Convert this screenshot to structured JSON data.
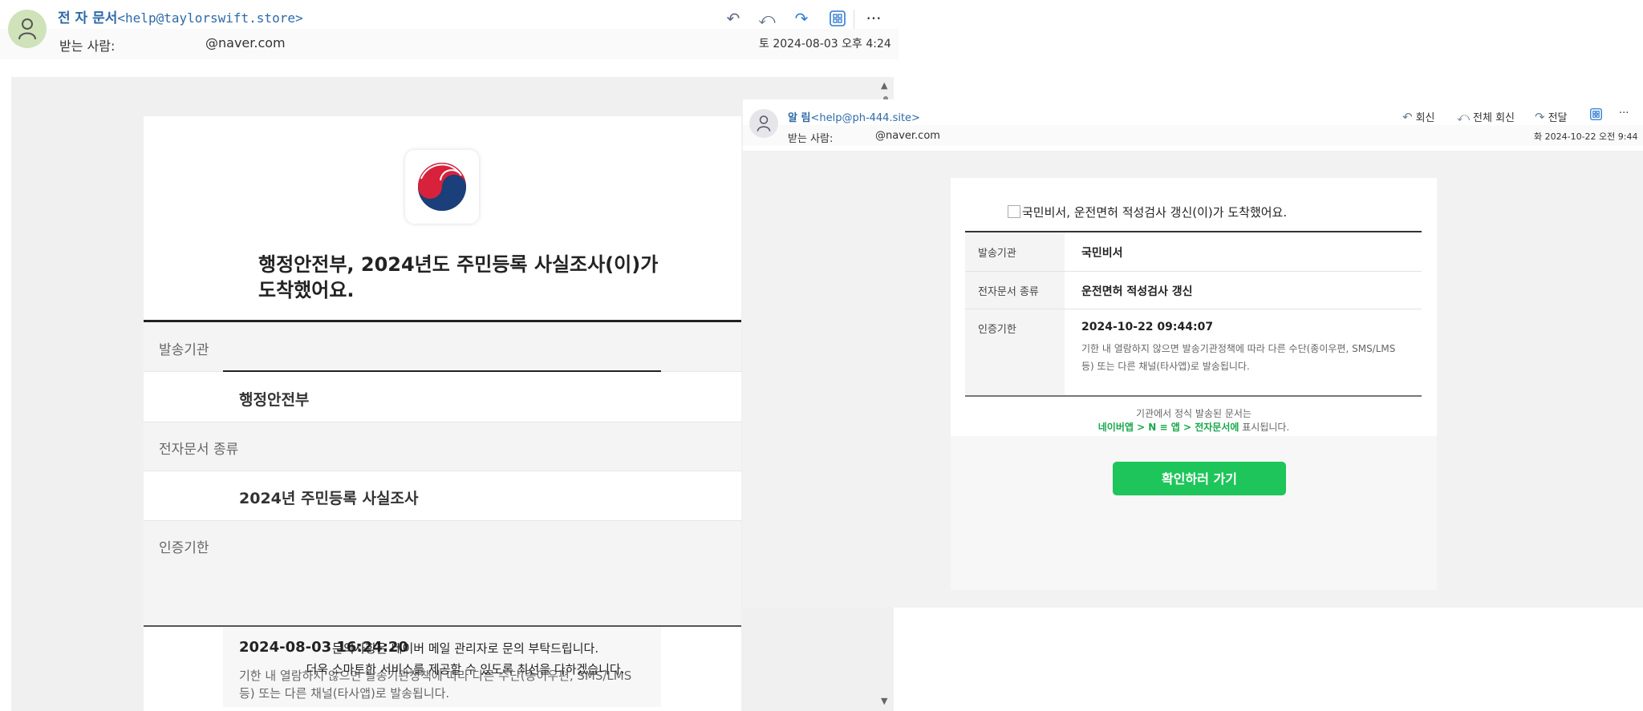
{
  "email1": {
    "sender_name": "전 자 문서",
    "sender_addr": "<help@taylorswift.store>",
    "to_label": "받는 사람:",
    "to_addr": "@naver.com",
    "date": "토 2024-08-03 오후 4:24",
    "title": "행정안전부, 2024년도 주민등록 사실조사(이)가 도착했어요.",
    "rows": [
      {
        "label": "발송기관",
        "value": "행정안전부"
      },
      {
        "label": "전자문서 종류",
        "value": "2024년 주민등록 사실조사"
      },
      {
        "label": "인증기한",
        "value": "2024-08-03 16:24:20"
      }
    ],
    "deadline_note": "기한 내 열람하지 않으면 발송기관정책에 따라 다른 수단(종이우편, SMS/LMS 등) 또는 다른 채널(타사앱)로 발송됩니다.",
    "overlay_line1": "문의사항은 네이버 메일 관리자로 문의 부탁드립니다.",
    "overlay_line2": "더욱 스마트한 서비스를 제공할 수 있도록 최선을 다하겠습니다."
  },
  "email2": {
    "sender_name": "알 림",
    "sender_addr": "<help@ph-444.site>",
    "to_label": "받는 사람:",
    "to_addr": "@naver.com",
    "date": "화 2024-10-22 오전 9:44",
    "actions": {
      "reply": "회신",
      "reply_all": "전체 회신",
      "forward": "전달"
    },
    "subject": "국민비서, 운전면허 적성검사 갱신(이)가 도착했어요.",
    "rows": [
      {
        "label": "발송기관",
        "value": "국민비서"
      },
      {
        "label": "전자문서 종류",
        "value": "운전면허 적성검사 갱신"
      },
      {
        "label": "인증기한",
        "value": "2024-10-22 09:44:07"
      }
    ],
    "deadline_note": "기한 내 열람하지 않으면 발송기관정책에 따라 다른 수단(종이우편, SMS/LMS 등) 또는 다른 채널(타사앱)로 발송됩니다.",
    "info_line1": "기관에서 정식 발송된 문서는",
    "info_highlight": "네이버앱 > N ≡ 앱 > 전자문서에",
    "info_tail": " 표시됩니다.",
    "cta": "확인하러 가기"
  },
  "icons": [
    "person-icon",
    "reply-icon",
    "reply-all-icon",
    "forward-icon",
    "apps-icon",
    "more-icon",
    "government-emblem-icon"
  ]
}
